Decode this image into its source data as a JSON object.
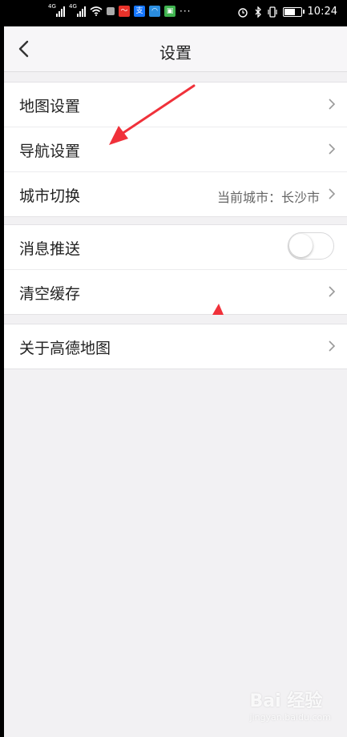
{
  "status_bar": {
    "network_1": "4G",
    "network_2": "4G",
    "time": "10:24",
    "more": "···",
    "app_icons": [
      "app-icon-1",
      "alipay-icon",
      "app-icon-3",
      "app-icon-4"
    ]
  },
  "header": {
    "title": "设置"
  },
  "groups": [
    {
      "rows": [
        {
          "label": "地图设置"
        },
        {
          "label": "导航设置"
        },
        {
          "label": "城市切换",
          "value": "当前城市：长沙市"
        }
      ]
    },
    {
      "rows": [
        {
          "label": "消息推送",
          "toggle": false
        },
        {
          "label": "清空缓存"
        }
      ]
    },
    {
      "rows": [
        {
          "label": "关于高德地图"
        }
      ]
    }
  ],
  "watermark": {
    "text": "Bai 经验",
    "sub": "jingyan.baidu.com"
  },
  "colors": {
    "annotation_arrow": "#f0313a",
    "page_bg": "#f2f1f3"
  }
}
